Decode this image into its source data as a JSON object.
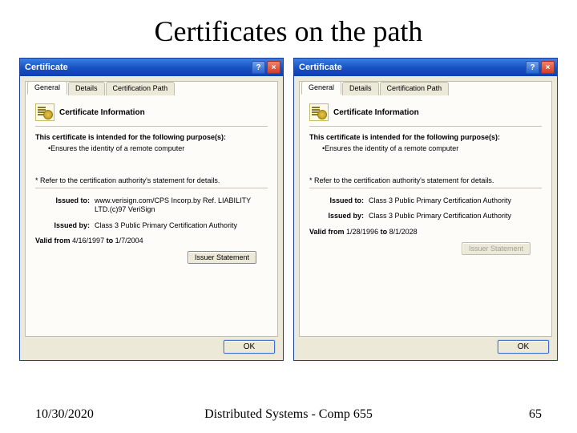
{
  "slide": {
    "title": "Certificates on the path",
    "date": "10/30/2020",
    "course": "Distributed Systems - Comp 655",
    "pageNumber": "65"
  },
  "dialogCommon": {
    "windowTitle": "Certificate",
    "tabs": {
      "general": "General",
      "details": "Details",
      "path": "Certification Path"
    },
    "heading": "Certificate Information",
    "purposeIntro": "This certificate is intended for the following purpose(s):",
    "purposeItem": "•Ensures the identity of a remote computer",
    "footnote": "* Refer to the certification authority's statement for details.",
    "labels": {
      "issuedTo": "Issued to:",
      "issuedBy": "Issued by:",
      "validFrom": "Valid from",
      "to": "to"
    },
    "buttons": {
      "issuerStatement": "Issuer Statement",
      "ok": "OK"
    }
  },
  "left": {
    "issuedTo": "www.verisign.com/CPS Incorp.by Ref. LIABILITY LTD.(c)97 VeriSign",
    "issuedBy": "Class 3 Public Primary Certification Authority",
    "validFrom": "4/16/1997",
    "validTo": "1/7/2004",
    "issuerStatementEnabled": true
  },
  "right": {
    "issuedTo": "Class 3 Public Primary Certification Authority",
    "issuedBy": "Class 3 Public Primary Certification Authority",
    "validFrom": "1/28/1996",
    "validTo": "8/1/2028",
    "issuerStatementEnabled": false
  }
}
